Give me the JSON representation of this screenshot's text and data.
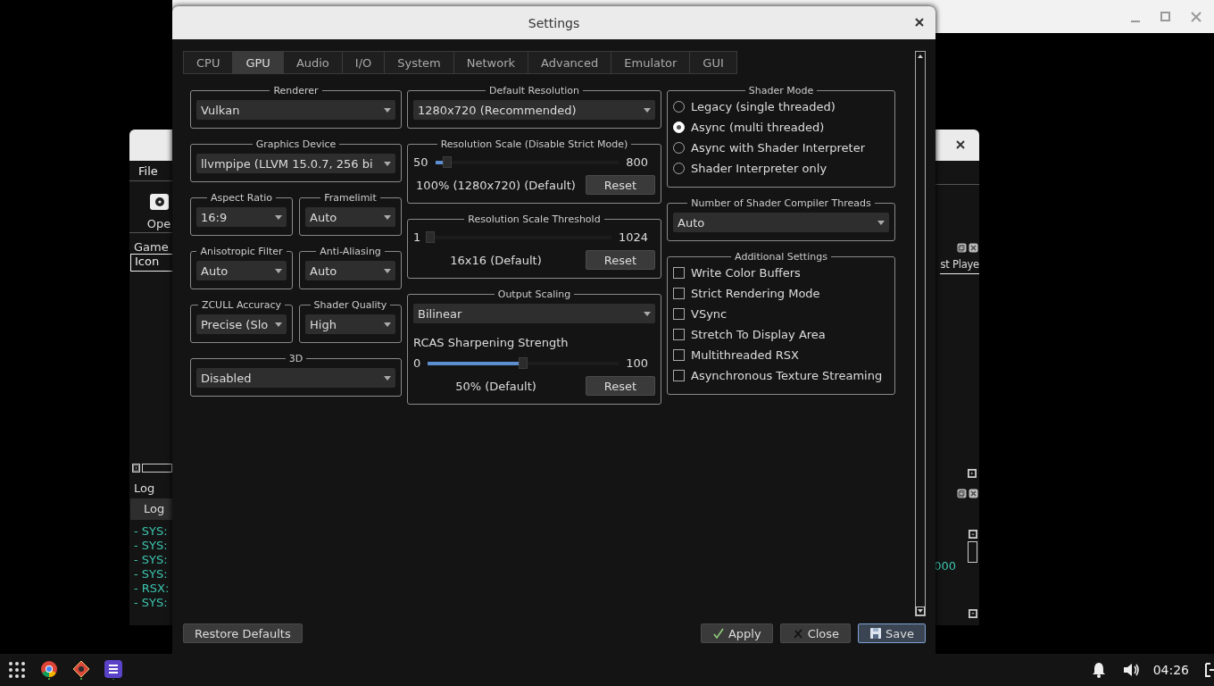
{
  "game_window": {
    "menu": [
      "File"
    ],
    "toolbar": [
      "Ope"
    ],
    "game_list": {
      "title": "Game",
      "columns": [
        "Icon",
        "st Playe"
      ]
    },
    "log": {
      "title": "Log",
      "tabs": [
        {
          "label": "Log",
          "selected": true
        }
      ],
      "lines": [
        "- SYS:",
        "- SYS:",
        "- SYS:",
        "- SYS:",
        "- RSX:",
        "- SYS:"
      ],
      "fragment": "000"
    }
  },
  "settings": {
    "title": "Settings",
    "tabs": [
      {
        "label": "CPU",
        "selected": false
      },
      {
        "label": "GPU",
        "selected": true
      },
      {
        "label": "Audio",
        "selected": false
      },
      {
        "label": "I/O",
        "selected": false
      },
      {
        "label": "System",
        "selected": false
      },
      {
        "label": "Network",
        "selected": false
      },
      {
        "label": "Advanced",
        "selected": false
      },
      {
        "label": "Emulator",
        "selected": false
      },
      {
        "label": "GUI",
        "selected": false
      }
    ],
    "columns": [
      {
        "rows": [
          {
            "groups": [
              {
                "title": "Renderer",
                "controls": [
                  {
                    "kind": "dropdown",
                    "value": "Vulkan"
                  }
                ]
              }
            ]
          },
          {
            "groups": [
              {
                "title": "Graphics Device",
                "controls": [
                  {
                    "kind": "dropdown",
                    "value": "llvmpipe (LLVM 15.0.7, 256 bi"
                  }
                ]
              }
            ]
          },
          {
            "groups": [
              {
                "title": "Aspect Ratio",
                "controls": [
                  {
                    "kind": "dropdown",
                    "value": "16:9"
                  }
                ]
              },
              {
                "title": "Framelimit",
                "controls": [
                  {
                    "kind": "dropdown",
                    "value": "Auto"
                  }
                ]
              }
            ]
          },
          {
            "groups": [
              {
                "title": "Anisotropic Filter",
                "controls": [
                  {
                    "kind": "dropdown",
                    "value": "Auto"
                  }
                ]
              },
              {
                "title": "Anti-Aliasing",
                "controls": [
                  {
                    "kind": "dropdown",
                    "value": "Auto"
                  }
                ]
              }
            ]
          },
          {
            "groups": [
              {
                "title": "ZCULL Accuracy",
                "controls": [
                  {
                    "kind": "dropdown",
                    "value": "Precise (Slo"
                  }
                ]
              },
              {
                "title": "Shader Quality",
                "controls": [
                  {
                    "kind": "dropdown",
                    "value": "High"
                  }
                ]
              }
            ]
          },
          {
            "groups": [
              {
                "title": "3D",
                "controls": [
                  {
                    "kind": "dropdown",
                    "value": "Disabled"
                  }
                ]
              }
            ]
          }
        ]
      },
      {
        "rows": [
          {
            "groups": [
              {
                "title": "Default Resolution",
                "controls": [
                  {
                    "kind": "dropdown",
                    "value": "1280x720 (Recommended)"
                  }
                ]
              }
            ]
          },
          {
            "groups": [
              {
                "title": "Resolution Scale (Disable Strict Mode)",
                "controls": [
                  {
                    "kind": "slider",
                    "min": "50",
                    "max": "800",
                    "level": 0.067
                  },
                  {
                    "kind": "reading",
                    "text": "100% (1280x720) (Default)",
                    "button": "Reset"
                  }
                ]
              }
            ]
          },
          {
            "groups": [
              {
                "title": "Resolution Scale Threshold",
                "controls": [
                  {
                    "kind": "slider",
                    "min": "1",
                    "max": "1024",
                    "level": 0.015
                  },
                  {
                    "kind": "reading",
                    "text": "16x16 (Default)",
                    "button": "Reset"
                  }
                ]
              }
            ]
          },
          {
            "groups": [
              {
                "title": "Output Scaling",
                "controls": [
                  {
                    "kind": "dropdown",
                    "value": "Bilinear"
                  },
                  {
                    "kind": "label",
                    "text": "RCAS Sharpening Strength"
                  },
                  {
                    "kind": "slider",
                    "min": "0",
                    "max": "100",
                    "level": 0.5
                  },
                  {
                    "kind": "reading",
                    "text": "50% (Default)",
                    "button": "Reset"
                  }
                ]
              }
            ]
          }
        ]
      },
      {
        "rows": [
          {
            "groups": [
              {
                "title": "Shader Mode",
                "controls": [
                  {
                    "kind": "radio",
                    "label": "Legacy (single threaded)",
                    "selected": false
                  },
                  {
                    "kind": "radio",
                    "label": "Async (multi threaded)",
                    "selected": true
                  },
                  {
                    "kind": "radio",
                    "label": "Async with Shader Interpreter",
                    "selected": false
                  },
                  {
                    "kind": "radio",
                    "label": "Shader Interpreter only",
                    "selected": false
                  }
                ]
              }
            ]
          },
          {
            "groups": [
              {
                "title": "Number of Shader Compiler Threads",
                "controls": [
                  {
                    "kind": "dropdown",
                    "value": "Auto"
                  }
                ]
              }
            ]
          },
          {
            "groups": [
              {
                "title": "Additional Settings",
                "controls": [
                  {
                    "kind": "checkbox",
                    "label": "Write Color Buffers",
                    "checked": false
                  },
                  {
                    "kind": "checkbox",
                    "label": "Strict Rendering Mode",
                    "checked": false
                  },
                  {
                    "kind": "checkbox",
                    "label": "VSync",
                    "checked": false
                  },
                  {
                    "kind": "checkbox",
                    "label": "Stretch To Display Area",
                    "checked": false
                  },
                  {
                    "kind": "checkbox",
                    "label": "Multithreaded RSX",
                    "checked": false
                  },
                  {
                    "kind": "checkbox",
                    "label": "Asynchronous Texture Streaming",
                    "checked": false
                  }
                ]
              }
            ]
          }
        ]
      }
    ],
    "footer": {
      "left": [
        {
          "label": "Restore Defaults",
          "default": false
        }
      ],
      "right": [
        {
          "label": "Apply",
          "kind": "apply",
          "default": false
        },
        {
          "label": "Close",
          "kind": "close",
          "default": false
        },
        {
          "label": "Save",
          "kind": "save",
          "default": true
        }
      ]
    }
  },
  "taskbar": {
    "clock": "04:26"
  }
}
